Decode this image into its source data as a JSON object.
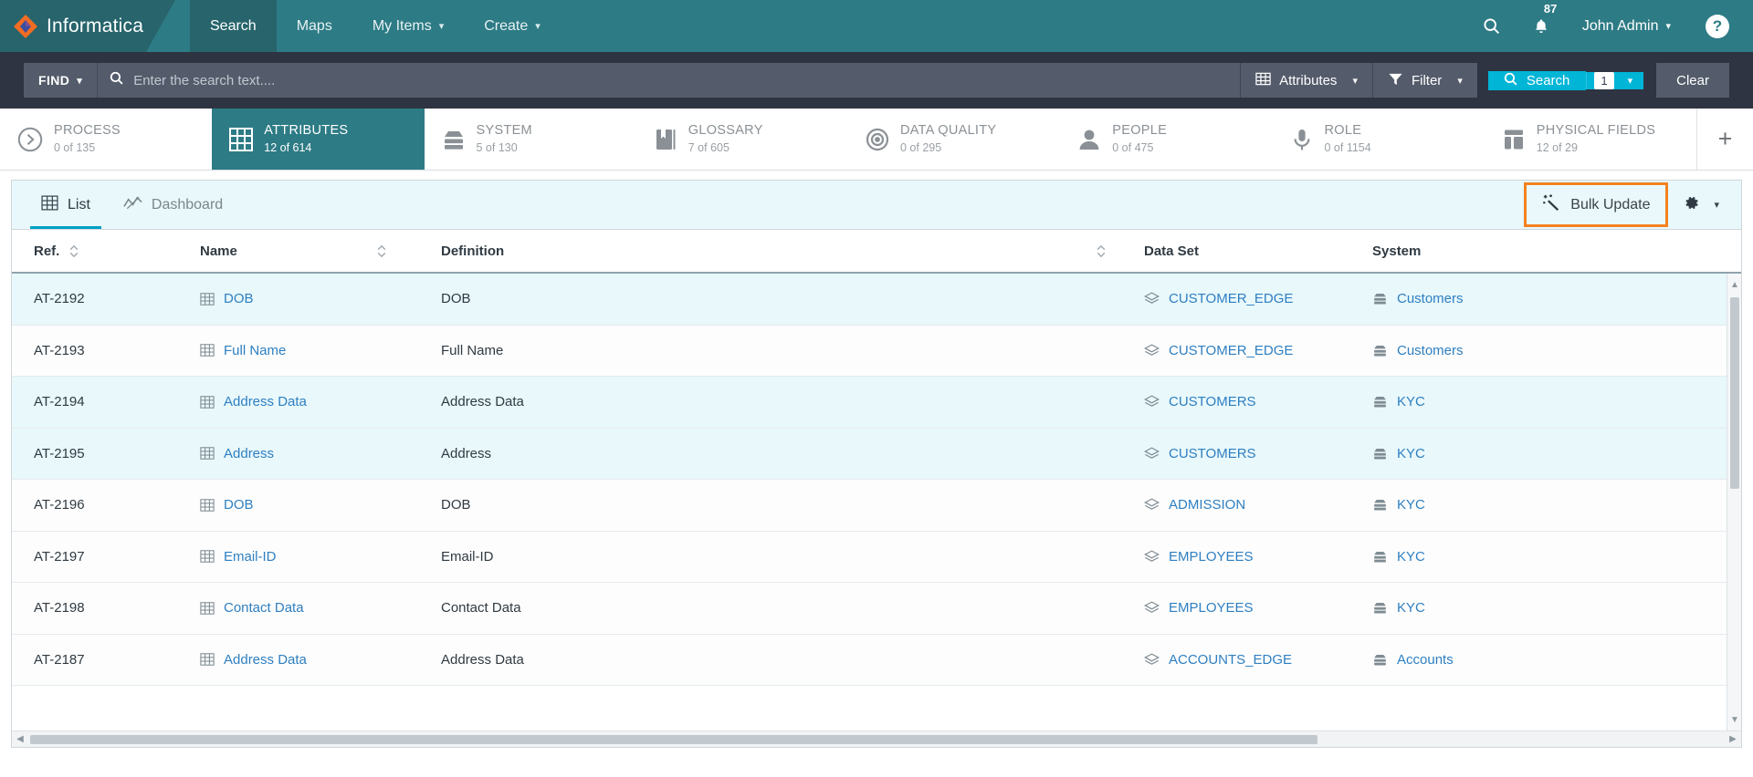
{
  "header": {
    "brand": "Informatica",
    "nav": [
      {
        "label": "Search",
        "active": true,
        "caret": false
      },
      {
        "label": "Maps",
        "active": false,
        "caret": false
      },
      {
        "label": "My Items",
        "active": false,
        "caret": true
      },
      {
        "label": "Create",
        "active": false,
        "caret": true
      }
    ],
    "search_icon": "search-icon",
    "notifications_icon": "bell-icon",
    "notifications_count": "87",
    "user_name": "John Admin",
    "help_label": "?",
    "brand_color": "#27646c",
    "nav_color": "#2d7b85"
  },
  "searchbar": {
    "find_label": "FIND",
    "search_placeholder": "Enter the search text....",
    "search_value": "",
    "attributes_label": "Attributes",
    "filter_label": "Filter",
    "search_button_label": "Search",
    "search_count": "1",
    "clear_label": "Clear",
    "accent_color": "#00b5d6"
  },
  "facets": [
    {
      "name": "PROCESS",
      "count": "0 of 135",
      "icon": "process-arrow-icon",
      "active": false
    },
    {
      "name": "ATTRIBUTES",
      "count": "12 of 614",
      "icon": "grid-icon",
      "active": true
    },
    {
      "name": "SYSTEM",
      "count": "5 of 130",
      "icon": "server-icon",
      "active": false
    },
    {
      "name": "GLOSSARY",
      "count": "7 of 605",
      "icon": "book-icon",
      "active": false
    },
    {
      "name": "DATA QUALITY",
      "count": "0 of 295",
      "icon": "target-icon",
      "active": false
    },
    {
      "name": "PEOPLE",
      "count": "0 of 475",
      "icon": "person-icon",
      "active": false
    },
    {
      "name": "ROLE",
      "count": "0 of 1154",
      "icon": "microphone-icon",
      "active": false
    },
    {
      "name": "PHYSICAL FIELDS",
      "count": "12 of 29",
      "icon": "fields-icon",
      "active": false
    }
  ],
  "facet_add_label": "+",
  "toolbar": {
    "list_tab": "List",
    "dashboard_tab": "Dashboard",
    "bulk_update_label": "Bulk Update",
    "bulk_update_icon": "magic-wand-icon",
    "gear_icon": "gear-icon",
    "highlight_color": "#f58220"
  },
  "table": {
    "columns": [
      {
        "label": "Ref.",
        "sortable": true
      },
      {
        "label": "Name",
        "sortable": true
      },
      {
        "label": "Definition",
        "sortable": true
      },
      {
        "label": "Data Set",
        "sortable": false
      },
      {
        "label": "System",
        "sortable": false
      }
    ],
    "rows": [
      {
        "ref": "AT-2192",
        "name": "DOB",
        "definition": "DOB",
        "data_set": "CUSTOMER_EDGE",
        "system": "Customers",
        "highlight": true
      },
      {
        "ref": "AT-2193",
        "name": "Full Name",
        "definition": "Full Name",
        "data_set": "CUSTOMER_EDGE",
        "system": "Customers",
        "highlight": false
      },
      {
        "ref": "AT-2194",
        "name": "Address Data",
        "definition": "Address Data",
        "data_set": "CUSTOMERS",
        "system": "KYC",
        "highlight": true
      },
      {
        "ref": "AT-2195",
        "name": "Address",
        "definition": "Address",
        "data_set": "CUSTOMERS",
        "system": "KYC",
        "highlight": true
      },
      {
        "ref": "AT-2196",
        "name": "DOB",
        "definition": "DOB",
        "data_set": "ADMISSION",
        "system": "KYC",
        "highlight": false
      },
      {
        "ref": "AT-2197",
        "name": "Email-ID",
        "definition": "Email-ID",
        "data_set": "EMPLOYEES",
        "system": "KYC",
        "highlight": false
      },
      {
        "ref": "AT-2198",
        "name": "Contact Data",
        "definition": "Contact Data",
        "data_set": "EMPLOYEES",
        "system": "KYC",
        "highlight": false
      },
      {
        "ref": "AT-2187",
        "name": "Address Data",
        "definition": "Address Data",
        "data_set": "ACCOUNTS_EDGE",
        "system": "Accounts",
        "highlight": false
      }
    ]
  }
}
